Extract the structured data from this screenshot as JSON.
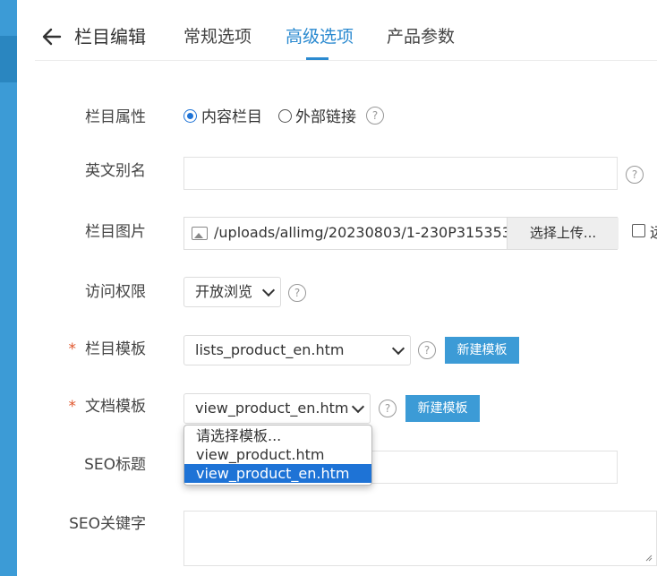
{
  "header": {
    "title": "栏目编辑",
    "tabs": [
      {
        "label": "常规选项"
      },
      {
        "label": "高级选项"
      },
      {
        "label": "产品参数"
      }
    ]
  },
  "form": {
    "attr": {
      "label": "栏目属性",
      "options": [
        {
          "label": "内容栏目",
          "checked": true
        },
        {
          "label": "外部链接",
          "checked": false
        }
      ]
    },
    "alias": {
      "label": "英文别名",
      "value": ""
    },
    "image": {
      "label": "栏目图片",
      "path": "/uploads/allimg/20230803/1-230P315353",
      "upload_label": "选择上传...",
      "extra_cut": "远"
    },
    "access": {
      "label": "访问权限",
      "value": "开放浏览"
    },
    "list_tpl": {
      "required": "*",
      "label": "栏目模板",
      "value": "lists_product_en.htm",
      "new_button": "新建模板"
    },
    "doc_tpl": {
      "required": "*",
      "label": "文档模板",
      "value": "view_product_en.htm",
      "new_button": "新建模板",
      "options": [
        "请选择模板...",
        "view_product.htm",
        "view_product_en.htm"
      ],
      "selected_index": 2
    },
    "seo_title": {
      "label": "SEO标题",
      "value": ""
    },
    "seo_keywords": {
      "label": "SEO关键字",
      "value": ""
    }
  },
  "icons": {
    "back": "arrow-left-icon",
    "help": "question-circle-icon",
    "image": "image-icon",
    "chevron": "chevron-down-icon"
  },
  "colors": {
    "accent": "#2b8ad0",
    "button": "#3c9bd6",
    "required": "#e0572e",
    "selected_option": "#1e73d6"
  }
}
